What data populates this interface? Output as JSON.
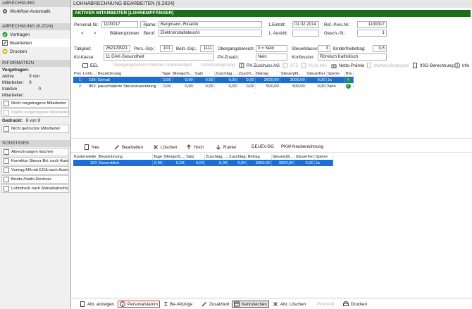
{
  "sidebar": {
    "section1": "ABRECHNUNG",
    "workflow": "Workflow-Automatik",
    "section2": "ABRECHNUNG (6.2024)",
    "vortragen": "Vortragen",
    "bearbeiten": "Bearbeiten",
    "drucken": "Drucken",
    "section3": "INFORMATION",
    "vorgetragen_label": "Vorgetragen:",
    "aktive_label": "Aktive Mitarbeiter:",
    "aktive_value": "9 von 9",
    "inaktive_label": "Inaktive Mitarbeiter:",
    "inaktive_value": "0",
    "nicht_vorgetragen": "Nicht vorgetragene Mitarbeiter",
    "inaktiv_vorgetragen": "Inaktiv vorgetragene Mitarbeiter",
    "gedruckt_label": "Gedruckt:",
    "gedruckt_value": "8 von 9",
    "nicht_gedruckt": "Nicht gedruckte Mitarbeiter",
    "section4": "SONSTIGES",
    "items": [
      "Abrechnungen löschen",
      "Korrektur Steuer-Brt. nach Austritt",
      "Vortrag MA mit EGA nach Austritt",
      "Brutto-/Netto-Rechner",
      "Lohndruck nach Monatsabschluss"
    ]
  },
  "main": {
    "title": "LOHNABRECHNUNG BEARBEITEN (6.2024)",
    "subtitle": "AKTIVER MITARBEITER [LOHNEMPFÄNGER]"
  },
  "form": {
    "personal_nr_label": "Personal-Nr.:",
    "personal_nr": "1100017",
    "dots": "...",
    "prev": "<",
    "next": ">",
    "blaetter": "Blätteroptionen",
    "name_label": "Name:",
    "name": "Bergmann, Ricardo",
    "beruf_label": "Beruf:",
    "beruf": "Elektroinstallateur/in",
    "eintritt_label": "1.Eintritt:",
    "eintritt": "01.02.2014",
    "austritt_label": "1. Austritt:",
    "austritt": "",
    "refpers_label": "Ref.-Pers.Nr.:",
    "refpers": "1100017",
    "geschst_label": "Gesch.-St.:",
    "geschst": "1",
    "taetigkeit_label": "Tätigkeit:",
    "taetigkeit": "262129921",
    "persgrp_label": "Pers.-Grp.:",
    "persgrp": "101",
    "beitrgrp_label": "Beitr.-Grp.:",
    "beitrgrp": "1111",
    "uebergang_label": "Übergangsbereich:",
    "uebergang": "0 = Nein",
    "steuerklasse_label": "Steuerklasse:",
    "steuerklasse": "3",
    "kinderfrei_label": "Kinderfreibetrag:",
    "kinderfrei": "0,5",
    "kvkasse_label": "KV-Kasse:",
    "kvkasse": "11 DAK-Gesundheit",
    "pvzusatz_label": "PV-Zusatz:",
    "pvzusatz": "Nein",
    "konfession_label": "Konfession:",
    "konfession": "Römisch Katholisch"
  },
  "toolbar1": [
    "EEL",
    "Übergangsbereich Fiktives Arbeitsentgelt",
    "Urlaubsabgeltung",
    "RV-Zuschuss AG",
    "ATZ",
    "KUG-Info",
    "Netto-Prämie",
    "Mutterschaftsgeld",
    "IfSG-Berechnung",
    "Info"
  ],
  "lohnarten": {
    "headers": [
      "Pos",
      "Lohn...",
      "Bezeichnung",
      "Tage",
      "Menge/S...",
      "Satz",
      "Zuschlag ...",
      "Zuschl...",
      "Betrag",
      "Steuerpfli...",
      "Steuerfrei",
      "Sperre",
      "BG"
    ],
    "rows": [
      [
        "1",
        "105",
        "Gehalt",
        "0,00",
        "0,00",
        "0,00",
        "0,00",
        "0,00",
        "3000,00",
        "3000,00",
        "0,00",
        "Ja",
        "✓"
      ],
      [
        "2",
        "852",
        "pauschalierte Steuerzuwendung",
        "0,00",
        "0,00",
        "0,00",
        "0,00",
        "0,00",
        "500,00",
        "500,00",
        "0,00",
        "Nein",
        "✓"
      ]
    ]
  },
  "toolbar2": [
    "Neu",
    "Bearbeiten",
    "Löschen",
    "Hoch",
    "Runter",
    "DEUEV-BG",
    "PKW-Neuberechnung"
  ],
  "kostenstellen": {
    "headers": [
      "Kostenstelle",
      "Bezeichnung",
      "Tage",
      "Menge/S...",
      "Satz",
      "Zuschlag ...",
      "Zuschlag",
      "Betrag",
      "Steuerpfli...",
      "Steuerfrei",
      "Sperre"
    ],
    "rows": [
      [
        "100",
        "Gewerblich",
        "0,00",
        "0,00",
        "0,00",
        "0,00",
        "0,00",
        "3000,00",
        "3000,00",
        "0,00",
        "Ja"
      ]
    ]
  },
  "bottombar": [
    "Abr. anzeigen",
    "Personalstamm",
    "Be-/Abzüge",
    "Zusatztext",
    "Kennzeichen",
    "Abr. Löschen",
    "Protokoll",
    "Drucken"
  ],
  "colors": {
    "accent_green": "#1f6a1c",
    "selection_blue": "#1a6fd6",
    "highlight_red": "#d93030"
  }
}
